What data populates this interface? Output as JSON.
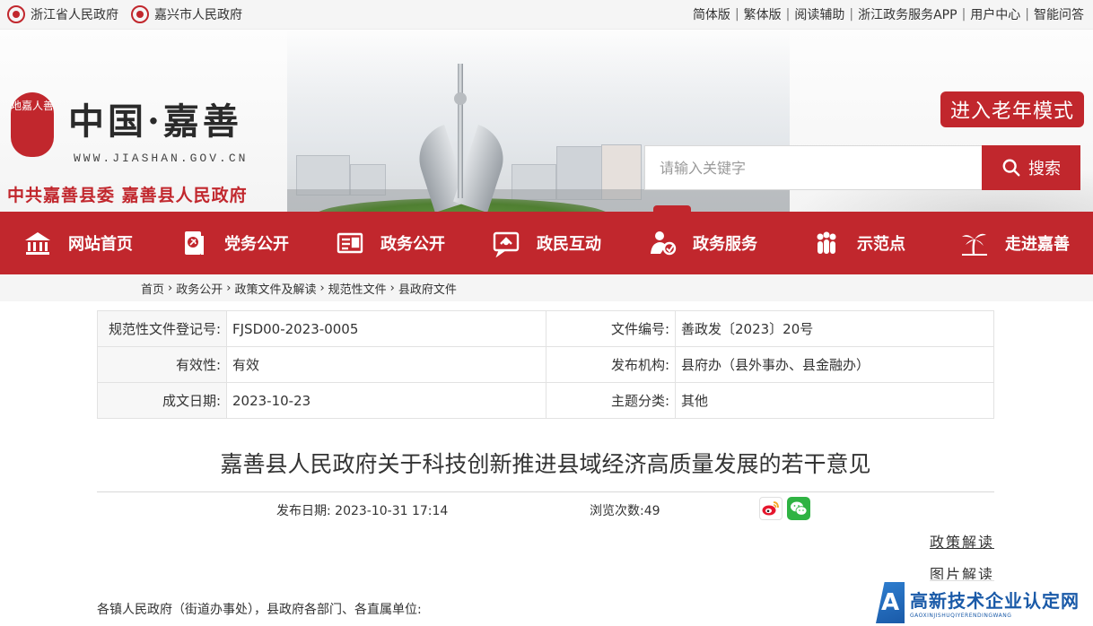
{
  "topbar": {
    "gov_links": [
      "浙江省人民政府",
      "嘉兴市人民政府"
    ],
    "right_links": [
      "简体版",
      "繁体版",
      "阅读辅助",
      "浙江政务服务APP",
      "用户中心",
      "智能问答"
    ]
  },
  "header": {
    "seal_text": "地嘉人善",
    "logo_title": "中国·嘉善",
    "logo_url": "WWW.JIASHAN.GOV.CN",
    "logo_sub": "中共嘉善县委  嘉善县人民政府",
    "elder_mode": "进入老年模式",
    "search_placeholder": "请输入关键字",
    "search_button": "搜索"
  },
  "nav": {
    "items": [
      {
        "label": "网站首页",
        "icon": "home-icon"
      },
      {
        "label": "党务公开",
        "icon": "party-icon"
      },
      {
        "label": "政务公开",
        "icon": "doc-icon"
      },
      {
        "label": "政民互动",
        "icon": "chat-icon"
      },
      {
        "label": "政务服务",
        "icon": "service-icon"
      },
      {
        "label": "示范点",
        "icon": "people-icon"
      },
      {
        "label": "走进嘉善",
        "icon": "palm-icon"
      }
    ]
  },
  "breadcrumb": [
    "首页",
    "政务公开",
    "政策文件及解读",
    "规范性文件",
    "县政府文件"
  ],
  "meta": {
    "rows": [
      {
        "l1": "规范性文件登记号:",
        "v1": "FJSD00-2023-0005",
        "l2": "文件编号:",
        "v2": "善政发〔2023〕20号"
      },
      {
        "l1": "有效性:",
        "v1": "有效",
        "l2": "发布机构:",
        "v2": "县府办（县外事办、县金融办）"
      },
      {
        "l1": "成文日期:",
        "v1": "2023-10-23",
        "l2": "主题分类:",
        "v2": "其他"
      }
    ]
  },
  "article": {
    "title": "嘉善县人民政府关于科技创新推进县域经济高质量发展的若干意见",
    "pub_date": "发布日期:   2023-10-31 17:14",
    "views": "浏览次数:49",
    "interp_policy": "政策解读",
    "interp_image": "图片解读",
    "salutation": "各镇人民政府（街道办事处），县政府各部门、各直属单位:"
  },
  "watermark": {
    "letter": "A",
    "cn": "高新技术企业认定网",
    "en": "GAOXINJISHUQIYERENDINGWANG"
  }
}
